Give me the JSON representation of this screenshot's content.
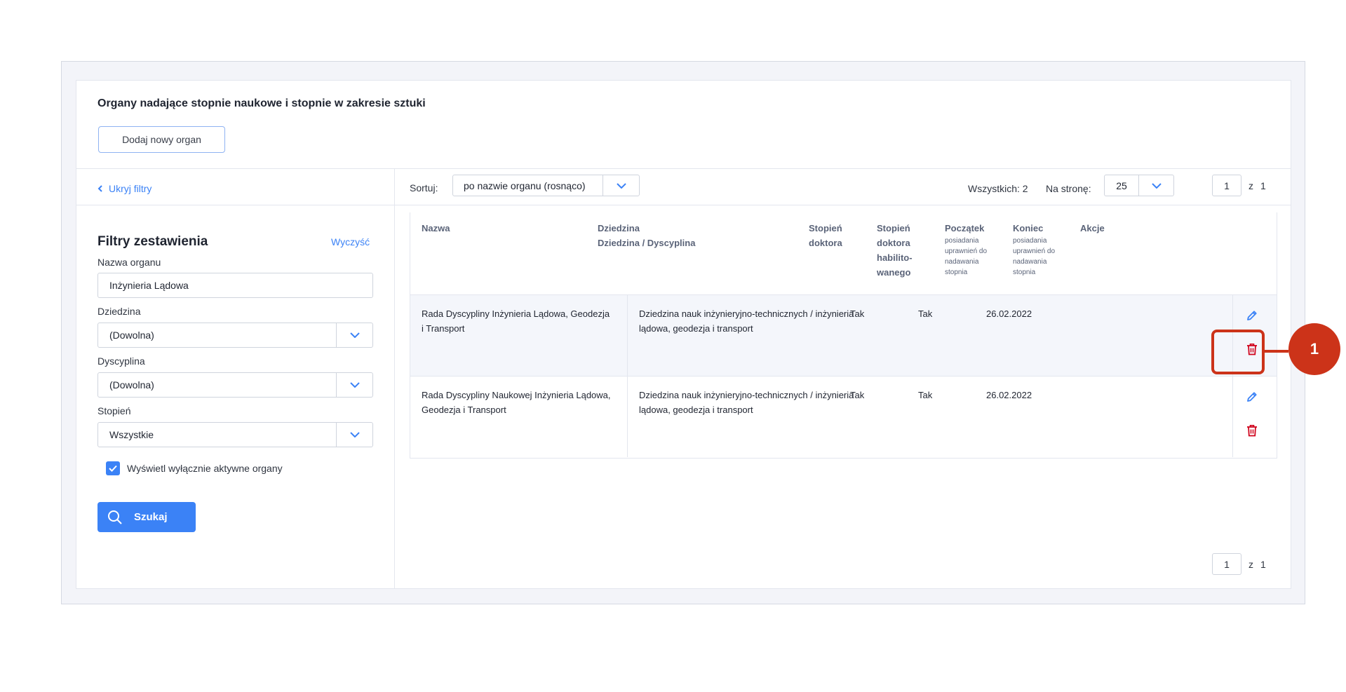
{
  "header": {
    "title": "Organy nadające stopnie naukowe i stopnie w zakresie sztuki",
    "add_button": "Dodaj nowy organ"
  },
  "filters": {
    "hide_label": "Ukryj filtry",
    "title": "Filtry zestawienia",
    "clear_label": "Wyczyść",
    "name_label": "Nazwa organu",
    "name_value": "Inżynieria Lądowa",
    "field_label": "Dziedzina",
    "field_value": "(Dowolna)",
    "discipline_label": "Dyscyplina",
    "discipline_value": "(Dowolna)",
    "degree_label": "Stopień",
    "degree_value": "Wszystkie",
    "active_only_label": "Wyświetl wyłącznie aktywne organy",
    "active_only_checked": true,
    "search_button": "Szukaj"
  },
  "toolbar": {
    "sort_label": "Sortuj:",
    "sort_value": "po nazwie organu (rosnąco)",
    "total_label": "Wszystkich: 2",
    "per_page_label": "Na stronę:",
    "per_page_value": "25",
    "page_value": "1",
    "page_of": "z",
    "page_total": "1"
  },
  "table": {
    "columns": {
      "name": "Nazwa",
      "field_line1": "Dziedzina",
      "field_line2": "Dziedzina / Dyscyplina",
      "doctor_line1": "Stopień",
      "doctor_line2": "doktora",
      "habil_line1": "Stopień",
      "habil_line2": "doktora",
      "habil_line3": "habilito-",
      "habil_line4": "wanego",
      "start_title": "Początek",
      "start_sub1": "posiadania",
      "start_sub2": "uprawnień do",
      "start_sub3": "nadawania",
      "start_sub4": "stopnia",
      "end_title": "Koniec",
      "end_sub1": "posiadania",
      "end_sub2": "uprawnień do",
      "end_sub3": "nadawania",
      "end_sub4": "stopnia",
      "actions": "Akcje"
    },
    "rows": [
      {
        "name_line1": "Rada Dyscypliny Inżynieria Lądowa, Geodezja",
        "name_line2": "i Transport",
        "field_line1": "Dziedzina nauk inżynieryjno-technicznych / inżynieria",
        "field_line2": "lądowa, geodezja i transport",
        "doctor": "Tak",
        "habil": "Tak",
        "start": "26.02.2022",
        "end": ""
      },
      {
        "name_line1": "Rada Dyscypliny Naukowej Inżynieria Lądowa,",
        "name_line2": "Geodezja i Transport",
        "field_line1": "Dziedzina nauk inżynieryjno-technicznych / inżynieria",
        "field_line2": "lądowa, geodezja i transport",
        "doctor": "Tak",
        "habil": "Tak",
        "start": "26.02.2022",
        "end": ""
      }
    ]
  },
  "bottom_pager": {
    "page_value": "1",
    "page_of": "z",
    "page_total": "1"
  },
  "annotation": {
    "callout_number": "1",
    "color": "#cc3319"
  },
  "colors": {
    "accent": "#3b82f6",
    "delete": "#d0021b"
  },
  "icons": {
    "edit": "pencil-icon",
    "delete": "trash-icon",
    "search": "search-icon",
    "chevron": "chevron-down-icon",
    "back": "chevron-left-icon",
    "check": "check-icon"
  }
}
